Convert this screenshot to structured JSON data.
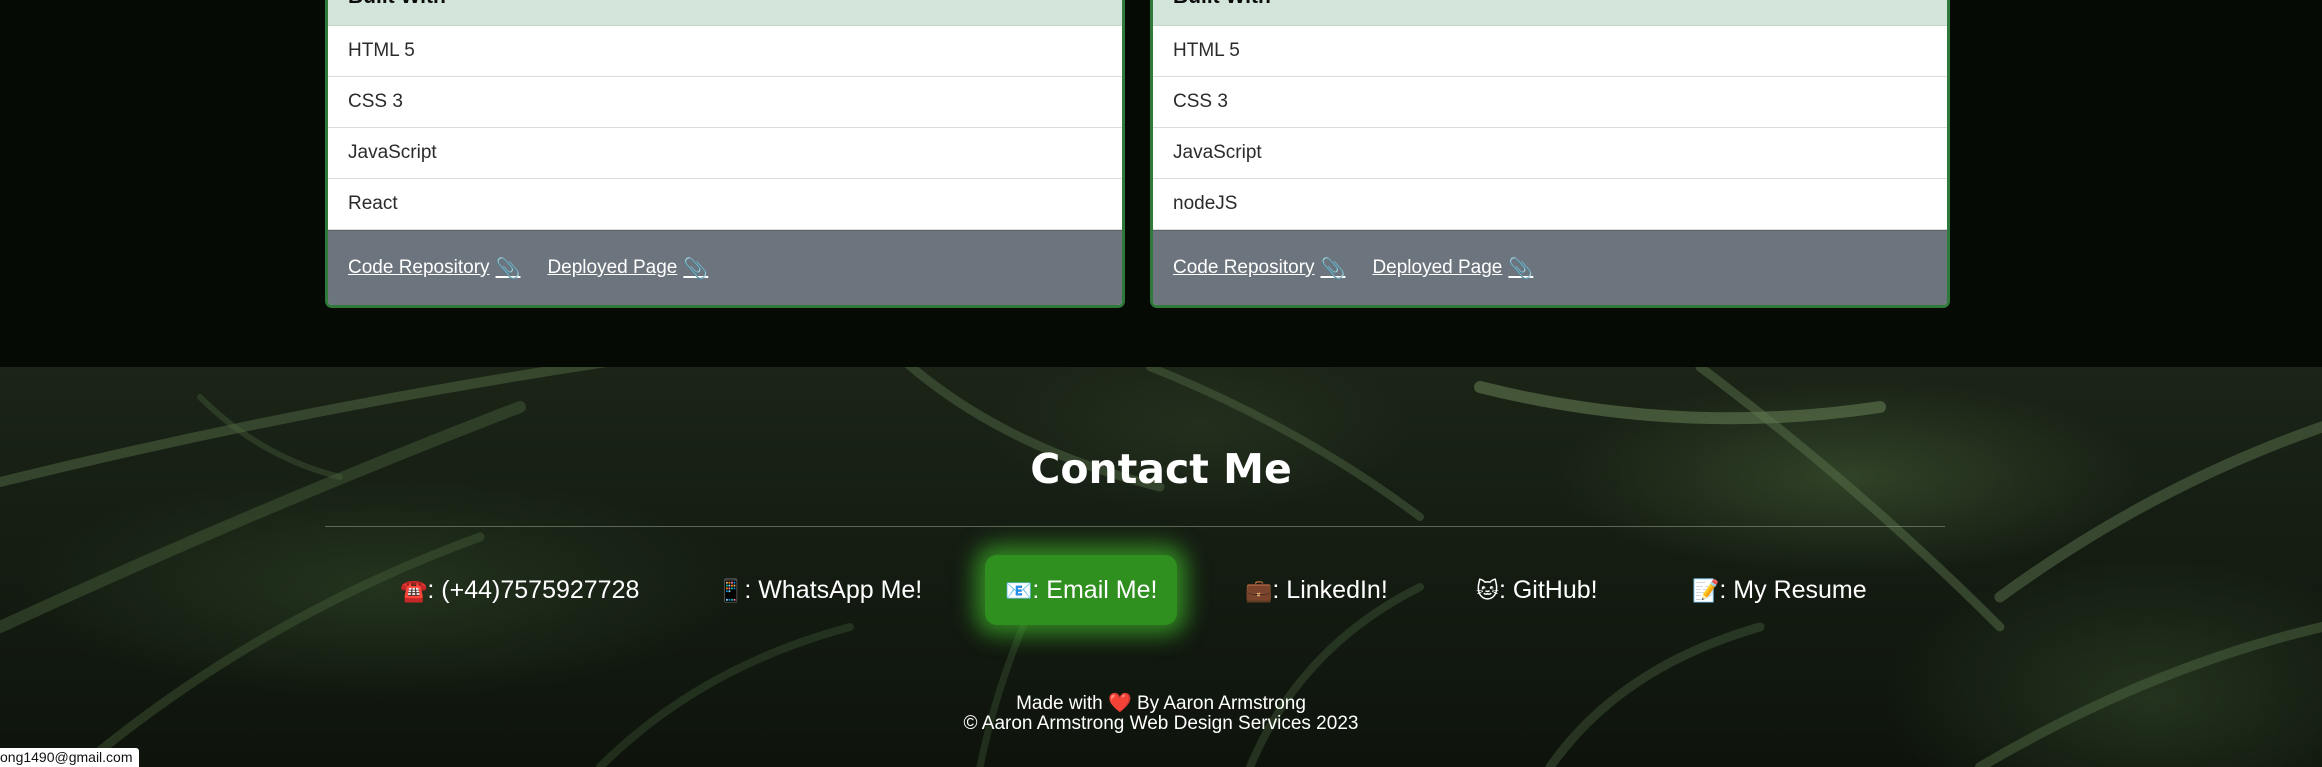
{
  "projects": [
    {
      "built_with_label": "Built With",
      "tech": [
        "HTML 5",
        "CSS 3",
        "JavaScript",
        "React"
      ],
      "links": {
        "repo": "Code Repository",
        "deployed": "Deployed Page",
        "icon": "📎"
      }
    },
    {
      "built_with_label": "Built With",
      "tech": [
        "HTML 5",
        "CSS 3",
        "JavaScript",
        "nodeJS"
      ],
      "links": {
        "repo": "Code Repository",
        "deployed": "Deployed Page",
        "icon": "📎"
      }
    }
  ],
  "contact": {
    "title": "Contact Me",
    "items": [
      {
        "icon": "☎️",
        "icon_name": "telephone-icon",
        "label": ": (+44)7575927728"
      },
      {
        "icon": "📱",
        "icon_name": "mobile-phone-icon",
        "label": ": WhatsApp Me!"
      },
      {
        "icon": "📧",
        "icon_name": "email-icon",
        "label": ": Email Me!"
      },
      {
        "icon": "💼",
        "icon_name": "briefcase-icon",
        "label": ": LinkedIn!"
      },
      {
        "icon": "🐱",
        "icon_name": "cat-icon",
        "label": ": GitHub!"
      },
      {
        "icon": "📝",
        "icon_name": "memo-icon",
        "label": ": My Resume"
      }
    ],
    "highlighted_item": "Email Me!"
  },
  "footer": {
    "made_with": "Made with",
    "heart": "❤️",
    "by": "By Aaron Armstrong",
    "copyright": "© Aaron Armstrong Web Design Services 2023"
  },
  "status_bar": {
    "url": "ong1490@gmail.com"
  },
  "colors": {
    "page_bg": "#060a05",
    "card_header_bg": "#d3e5db",
    "card_border": "#2f7a3b",
    "card_footer_bg": "#6c757d",
    "highlight_green": "#2f8f1f"
  }
}
